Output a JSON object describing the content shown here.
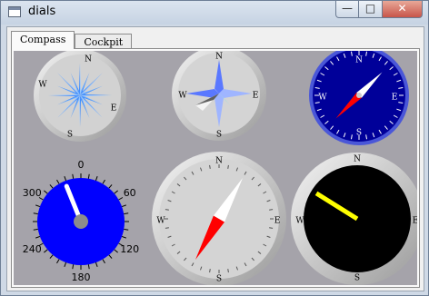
{
  "window": {
    "title": "dials",
    "min_glyph": "—",
    "max_glyph": "□",
    "close_glyph": "✕"
  },
  "tabs": [
    {
      "label": "Compass",
      "selected": true
    },
    {
      "label": "Cockpit",
      "selected": false
    }
  ],
  "compasses": {
    "rose": {
      "n": "N",
      "e": "E",
      "s": "S",
      "w": "W"
    },
    "star": {
      "n": "N",
      "e": "E",
      "s": "S",
      "w": "W"
    },
    "blue": {
      "n": "N",
      "e": "E",
      "s": "S",
      "w": "W",
      "needle_degrees": 45
    },
    "large": {
      "n": "N",
      "e": "E",
      "s": "S",
      "w": "W",
      "needle_degrees": 210
    },
    "black": {
      "n": "N",
      "e": "E",
      "s": "S",
      "w": "W",
      "needle_degrees": 302
    }
  },
  "speed_dial": {
    "scale_labels": [
      "0",
      "60",
      "120",
      "180",
      "240",
      "300"
    ],
    "needle_value": 338,
    "face_color": "#0000ff"
  },
  "colors": {
    "dial_background": "#a5a3aa",
    "needle_red": "#ff0000",
    "needle_white": "#ffffff",
    "needle_yellow": "#ffff00",
    "rose_blue": "#3b8bff",
    "navy_face": "#000099"
  }
}
